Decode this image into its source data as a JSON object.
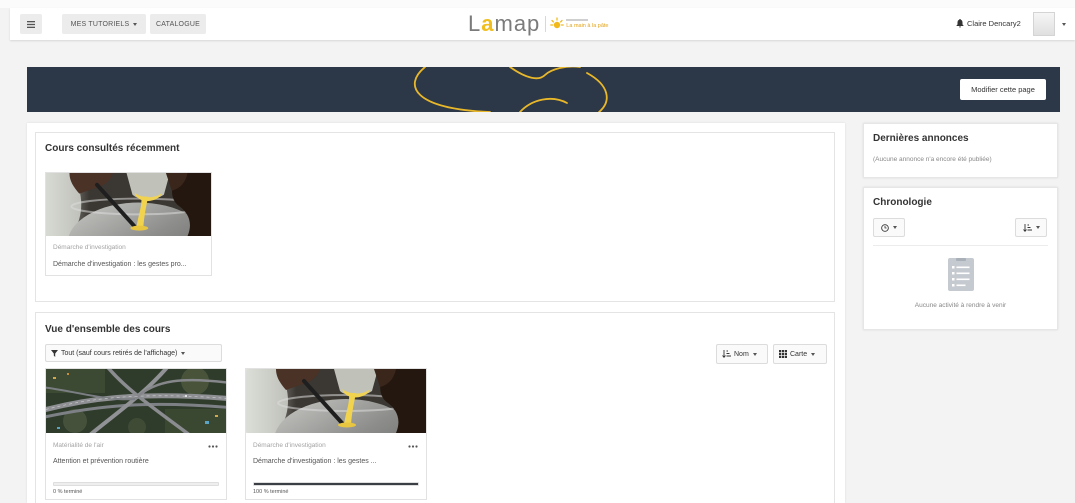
{
  "header": {
    "nav": [
      {
        "label": "MES TUTORIELS"
      },
      {
        "label": "CATALOGUE"
      }
    ],
    "logo": {
      "l": "L",
      "a": "a",
      "map": "map",
      "tagline": "La main à la pâte"
    },
    "user": {
      "name": "Claire Dencary2"
    }
  },
  "banner": {
    "edit_button": "Modifier cette page"
  },
  "recent": {
    "title": "Cours consultés récemment",
    "courses": [
      {
        "category": "Démarche d'investigation",
        "name": "Démarche d'investigation : les gestes pro..."
      }
    ]
  },
  "overview": {
    "title": "Vue d'ensemble des cours",
    "filter": "Tout (sauf cours retirés de l'affichage)",
    "sort": "Nom",
    "view": "Carte",
    "courses": [
      {
        "category": "Matérialité de l'air",
        "name": "Attention et prévention routière",
        "progress": 0,
        "progress_label": "0 % terminé"
      },
      {
        "category": "Démarche d'investigation",
        "name": "Démarche d'investigation : les gestes ...",
        "progress": 100,
        "progress_label": "100 % terminé"
      }
    ]
  },
  "announcements": {
    "title": "Dernières annonces",
    "empty": "(Aucune annonce n'a encore été publiée)"
  },
  "timeline": {
    "title": "Chronologie",
    "empty": "Aucune activité à rendre à venir"
  },
  "icons": {
    "menu": "hamburger-icon",
    "caret": "caret-down-icon",
    "logo_mark": "sun-icon",
    "bell": "bell-icon",
    "filter": "filter-icon",
    "sort": "sort-icon",
    "view": "grid-icon",
    "course_menu": "more-dots-icon",
    "timeline_filter": "clock-icon",
    "timeline_empty": "document-list-icon"
  },
  "colors": {
    "banner": "#2c3747",
    "accent": "#f0bf1f",
    "progress": "#3a3f45"
  }
}
